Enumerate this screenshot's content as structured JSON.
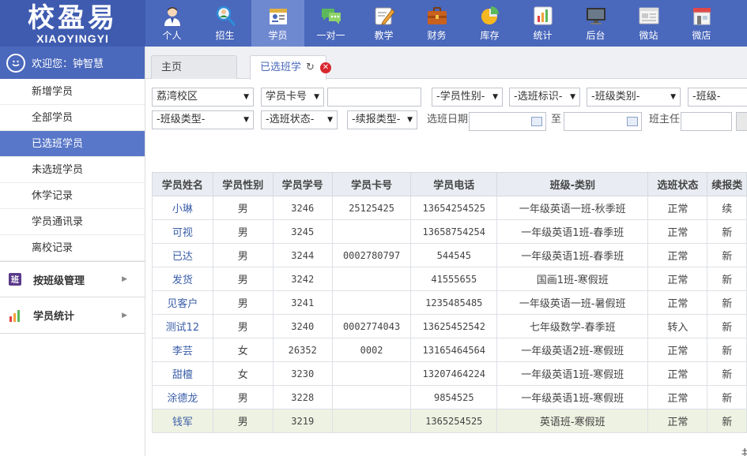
{
  "logo": {
    "cn": "校盈易",
    "en": "XIAOYINGYI"
  },
  "nav": [
    {
      "label": "个人",
      "icon": "person-icon"
    },
    {
      "label": "招生",
      "icon": "recruit-search-icon"
    },
    {
      "label": "学员",
      "icon": "student-card-icon"
    },
    {
      "label": "一对一",
      "icon": "chat-bubbles-icon"
    },
    {
      "label": "教学",
      "icon": "teaching-pen-icon"
    },
    {
      "label": "财务",
      "icon": "briefcase-icon"
    },
    {
      "label": "库存",
      "icon": "pie-chart-icon"
    },
    {
      "label": "统计",
      "icon": "bar-chart-icon"
    },
    {
      "label": "后台",
      "icon": "monitor-icon"
    },
    {
      "label": "微站",
      "icon": "web-page-icon"
    },
    {
      "label": "微店",
      "icon": "shop-icon"
    }
  ],
  "nav_active": "学员",
  "sidebar": {
    "welcome": "欢迎您：钟智慧",
    "items": [
      "新增学员",
      "全部学员",
      "已选班学员",
      "未选班学员",
      "休学记录",
      "学员通讯录",
      "离校记录"
    ],
    "active": "已选班学员",
    "groups": [
      {
        "label": "按班级管理",
        "icon": "class-badge-icon",
        "badge": "班"
      },
      {
        "label": "学员统计",
        "icon": "stats-bars-icon"
      }
    ]
  },
  "tabs": {
    "home": "主页",
    "current": "已选班学"
  },
  "filters": {
    "campus": "荔湾校区",
    "card_type": "学员卡号",
    "card_value": "",
    "gender": "-学员性别-",
    "mark": "-选班标识-",
    "class_category": "-班级类别-",
    "class_level": "-班级-",
    "class_type": "-班级类型-",
    "status": "-选班状态-",
    "renew_type": "-续报类型-",
    "date_label": "选班日期",
    "date_from": "",
    "to_label": "至",
    "date_to": "",
    "teacher_label": "班主任",
    "teacher_value": ""
  },
  "table": {
    "columns": [
      "学员姓名",
      "学员性别",
      "学员学号",
      "学员卡号",
      "学员电话",
      "班级-类别",
      "选班状态",
      "续报类"
    ],
    "rows": [
      [
        "小琳",
        "男",
        "3246",
        "25125425",
        "13654254525",
        "一年级英语一班-秋季班",
        "正常",
        "续"
      ],
      [
        "可视",
        "男",
        "3245",
        "",
        "13658754254",
        "一年级英语1班-春季班",
        "正常",
        "新"
      ],
      [
        "已达",
        "男",
        "3244",
        "0002780797",
        "544545",
        "一年级英语1班-春季班",
        "正常",
        "新"
      ],
      [
        "发货",
        "男",
        "3242",
        "",
        "41555655",
        "国画1班-寒假班",
        "正常",
        "新"
      ],
      [
        "见客户",
        "男",
        "3241",
        "",
        "1235485485",
        "一年级英语一班-暑假班",
        "正常",
        "新"
      ],
      [
        "测试12",
        "男",
        "3240",
        "0002774043",
        "13625452542",
        "七年级数学-春季班",
        "转入",
        "新"
      ],
      [
        "李芸",
        "女",
        "26352",
        "0002",
        "13165464564",
        "一年级英语2班-寒假班",
        "正常",
        "新"
      ],
      [
        "甜檀",
        "女",
        "3230",
        "",
        "13207464224",
        "一年级英语1班-寒假班",
        "正常",
        "新"
      ],
      [
        "涂德龙",
        "男",
        "3228",
        "",
        "9854525",
        "一年级英语1班-寒假班",
        "正常",
        "新"
      ],
      [
        "钱军",
        "男",
        "3219",
        "",
        "1365254525",
        "英语班-寒假班",
        "正常",
        "新"
      ]
    ],
    "highlight_row": 9
  },
  "pager_fragment": "共"
}
